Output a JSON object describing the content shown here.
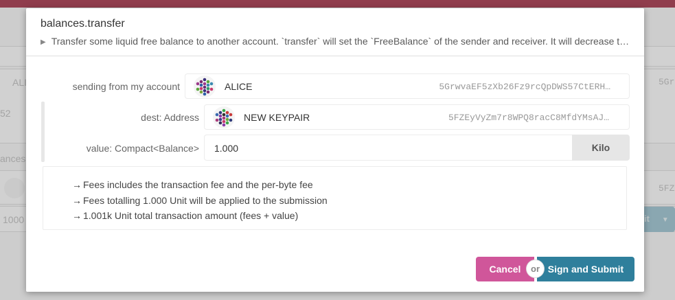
{
  "background": {
    "row1_left": "ALI",
    "row1_right": "5Gr",
    "row2_left": "52",
    "row3_left": "ances",
    "row4_right": "5FZ",
    "row5_left": "1000",
    "submit_fragment": "nit"
  },
  "modal": {
    "title": "balances.transfer",
    "description": "Transfer some liquid free balance to another account. `transfer` will set the `FreeBalance` of the sender and receiver. It will decrease the total issuance of the system by the `TransferFee`."
  },
  "sender": {
    "label": "sending from my account",
    "name": "ALICE",
    "address": "5GrwvaEF5zXb26Fz9rcQpDWS57CtERH…"
  },
  "dest": {
    "label": "dest: Address",
    "name": "NEW KEYPAIR",
    "address": "5FZEyVyZm7r8WPQ8racC8MfdYMsAJ…"
  },
  "value": {
    "label": "value: Compact<Balance>",
    "amount": "1.000",
    "unit": "Kilo"
  },
  "fees": {
    "lines": [
      "Fees includes the transaction fee and the per-byte fee",
      "Fees totalling 1.000 Unit will be applied to the submission",
      "1.001k Unit total transaction amount (fees + value)"
    ]
  },
  "actions": {
    "cancel": "Cancel",
    "or": "or",
    "submit": "Sign and Submit"
  },
  "colors": {
    "cancel": "#d0569a",
    "submit": "#2f7f9c",
    "topbar": "#b04b5e"
  },
  "icons": [
    "caret-right-icon",
    "identicon-alice",
    "identicon-new-keypair",
    "arrow-right-icon"
  ]
}
